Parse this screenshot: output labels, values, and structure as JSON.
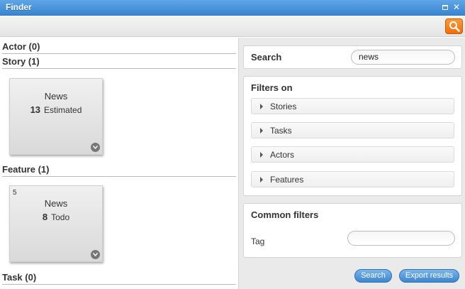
{
  "window": {
    "title": "Finder"
  },
  "results": {
    "actor_header": "Actor (0)",
    "story_header": "Story (1)",
    "feature_header": "Feature (1)",
    "task_header": "Task (0)",
    "story_card": {
      "name": "News",
      "number": "13",
      "status": "Estimated"
    },
    "feature_card": {
      "corner": "5",
      "name": "News",
      "number": "8",
      "status": "Todo"
    }
  },
  "search_panel": {
    "label": "Search",
    "value": "news"
  },
  "filters_panel": {
    "title": "Filters on",
    "items": [
      "Stories",
      "Tasks",
      "Actors",
      "Features"
    ]
  },
  "common_filters": {
    "title": "Common filters",
    "tag_label": "Tag",
    "tag_value": ""
  },
  "actions": {
    "search_label": "Search",
    "export_label": "Export results"
  }
}
